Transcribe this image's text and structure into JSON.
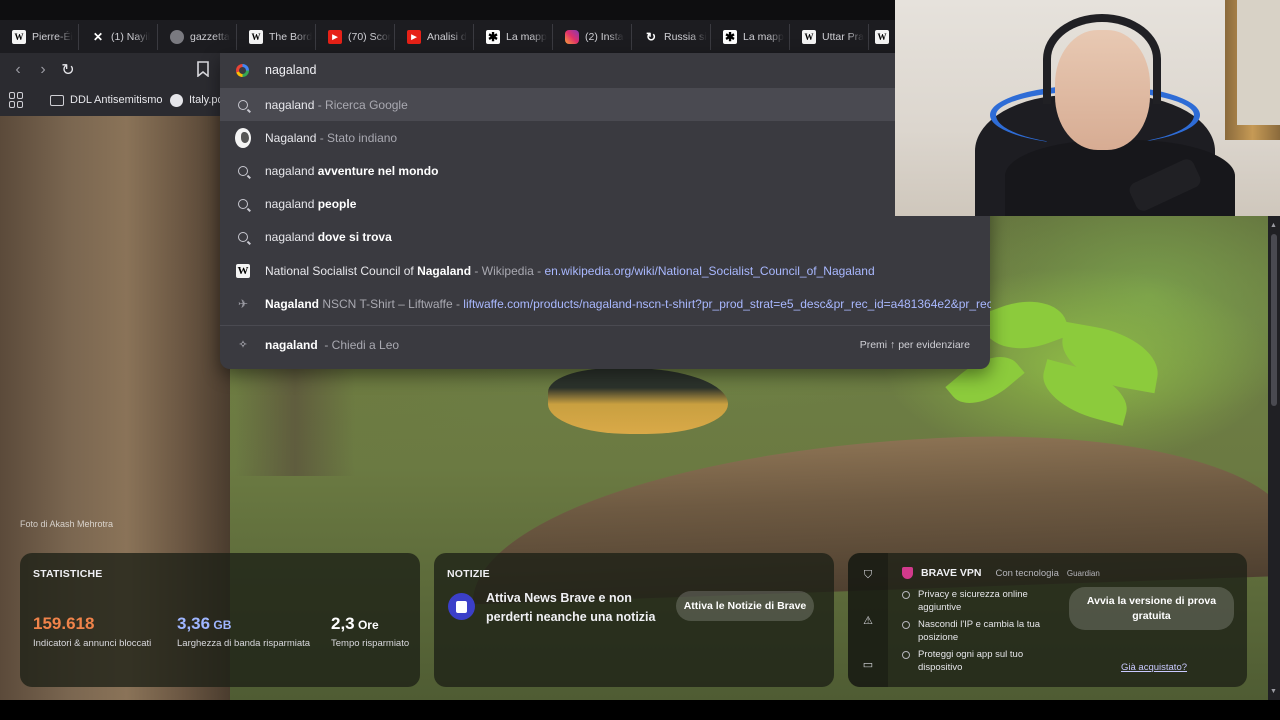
{
  "tabs": [
    {
      "label": "Pierre-Éi",
      "icon": "wikipedia-icon"
    },
    {
      "label": "(1) Nayil",
      "icon": "x-icon"
    },
    {
      "label": "gazzetta",
      "icon": "globe-icon"
    },
    {
      "label": "The Bord",
      "icon": "wikipedia-icon"
    },
    {
      "label": "(70) Scor",
      "icon": "youtube-icon"
    },
    {
      "label": "Analisi d",
      "icon": "youtube-icon"
    },
    {
      "label": "La mapp",
      "icon": "asterisk-icon"
    },
    {
      "label": "(2) Insta",
      "icon": "instagram-icon"
    },
    {
      "label": "Russia si",
      "icon": "refresh-icon"
    },
    {
      "label": "La mapp",
      "icon": "asterisk-icon"
    },
    {
      "label": "Uttar Pra",
      "icon": "wikipedia-icon"
    },
    {
      "label": "",
      "icon": "wikipedia-icon"
    }
  ],
  "omnibox": {
    "query": "nagaland",
    "suggestions": [
      {
        "icon": "search-icon",
        "prefix": "nagaland",
        "bold": "",
        "suffix": " - Ricerca Google",
        "url": ""
      },
      {
        "icon": "map-icon",
        "prefix": "Nagaland",
        "bold": "",
        "suffix": " - Stato indiano",
        "url": ""
      },
      {
        "icon": "search-icon",
        "prefix": "nagaland ",
        "bold": "avventure nel mondo",
        "suffix": "",
        "url": ""
      },
      {
        "icon": "search-icon",
        "prefix": "nagaland ",
        "bold": "people",
        "suffix": "",
        "url": ""
      },
      {
        "icon": "search-icon",
        "prefix": "nagaland ",
        "bold": "dove si trova",
        "suffix": "",
        "url": ""
      },
      {
        "icon": "wikipedia-icon",
        "prefix": "National Socialist Council of ",
        "bold": "Nagaland",
        "suffix": " - Wikipedia - ",
        "url": "en.wikipedia.org/wiki/National_Socialist_Council_of_Nagaland"
      },
      {
        "icon": "liftwaffe-icon",
        "prefix": "",
        "bold": "Nagaland",
        "suffix": " NSCN T-Shirt – Liftwaffe - ",
        "url": "liftwaffe.com/products/nagaland-nscn-t-shirt?pr_prod_strat=e5_desc&pr_rec_id=a481364e2&pr_rec..."
      }
    ],
    "leo": {
      "bold": "nagaland",
      "suffix": "  - Chiedi a Leo",
      "hint": "Premi ↑ per evidenziare"
    }
  },
  "bookmarks": [
    {
      "label": "DDL Antisemitismo",
      "icon": "folder-icon"
    },
    {
      "label": "Italy.pd",
      "icon": "globe-icon"
    }
  ],
  "photo_credit": "Foto di Akash Mehrotra",
  "stats": {
    "title": "STATISTICHE",
    "items": [
      {
        "value": "159.618",
        "unit": "",
        "label": "Indicatori & annunci bloccati",
        "color": "#f0834a"
      },
      {
        "value": "3,36",
        "unit": " GB",
        "label": "Larghezza di banda risparmiata",
        "color": "#9fb6ff"
      },
      {
        "value": "2,3",
        "unit": " Ore",
        "label": "Tempo risparmiato",
        "color": "#ffffff"
      }
    ]
  },
  "news": {
    "title": "NOTIZIE",
    "text": "Attiva News Brave e non perderti neanche una notizia",
    "button": "Attiva le Notizie di Brave"
  },
  "vpn": {
    "title": "BRAVE VPN",
    "tech": "Con tecnologia",
    "partner": "Guardian",
    "features": [
      "Privacy e sicurezza online aggiuntive",
      "Nascondi l'IP e cambia la tua posizione",
      "Proteggi ogni app sul tuo dispositivo"
    ],
    "button": "Avvia la versione di prova gratuita",
    "link": "Già acquistato?"
  },
  "colors": {
    "accent": "#f0834a",
    "vpn_shield": "#d23a8c",
    "link": "#a9b8ff"
  }
}
